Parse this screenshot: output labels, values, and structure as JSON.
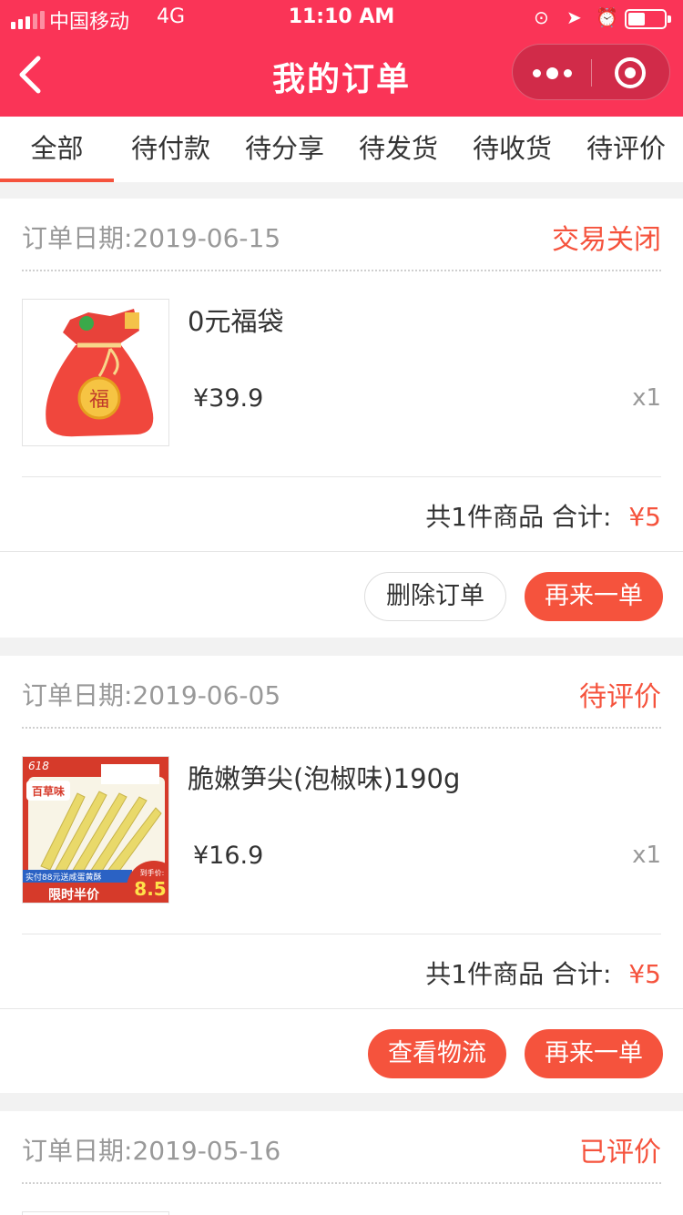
{
  "status_bar": {
    "carrier": "中国移动",
    "network": "4G",
    "time": "11:10 AM"
  },
  "nav": {
    "title": "我的订单"
  },
  "tabs": [
    {
      "label": "全部",
      "active": true
    },
    {
      "label": "待付款",
      "active": false
    },
    {
      "label": "待分享",
      "active": false
    },
    {
      "label": "待发货",
      "active": false
    },
    {
      "label": "待收货",
      "active": false
    },
    {
      "label": "待评价",
      "active": false
    }
  ],
  "orders": [
    {
      "date_label": "订单日期:",
      "date": "2019-06-15",
      "status": "交易关闭",
      "item": {
        "name": "0元福袋",
        "price": "¥39.9",
        "qty": "x1",
        "image_text": "福"
      },
      "summary": {
        "count": "共1件商品",
        "total_label": "合计:",
        "total": "¥5"
      },
      "buttons": [
        "删除订单",
        "再来一单"
      ]
    },
    {
      "date_label": "订单日期:",
      "date": "2019-06-05",
      "status": "待评价",
      "item": {
        "name": "脆嫩笋尖(泡椒味)190g",
        "price": "¥16.9",
        "qty": "x1",
        "image_texts": {
          "campaign": "618",
          "brand": "百草味",
          "banner": "实付88元送咸蛋黄酥",
          "deal": "限时半价",
          "price_tag": "到手价:",
          "price_value": "8.5"
        }
      },
      "summary": {
        "count": "共1件商品",
        "total_label": "合计:",
        "total": "¥5"
      },
      "buttons": [
        "查看物流",
        "再来一单"
      ]
    },
    {
      "date_label": "订单日期:",
      "date": "2019-05-16",
      "status": "已评价"
    }
  ],
  "colors": {
    "header": "#fa3457",
    "accent": "#f5533d"
  }
}
